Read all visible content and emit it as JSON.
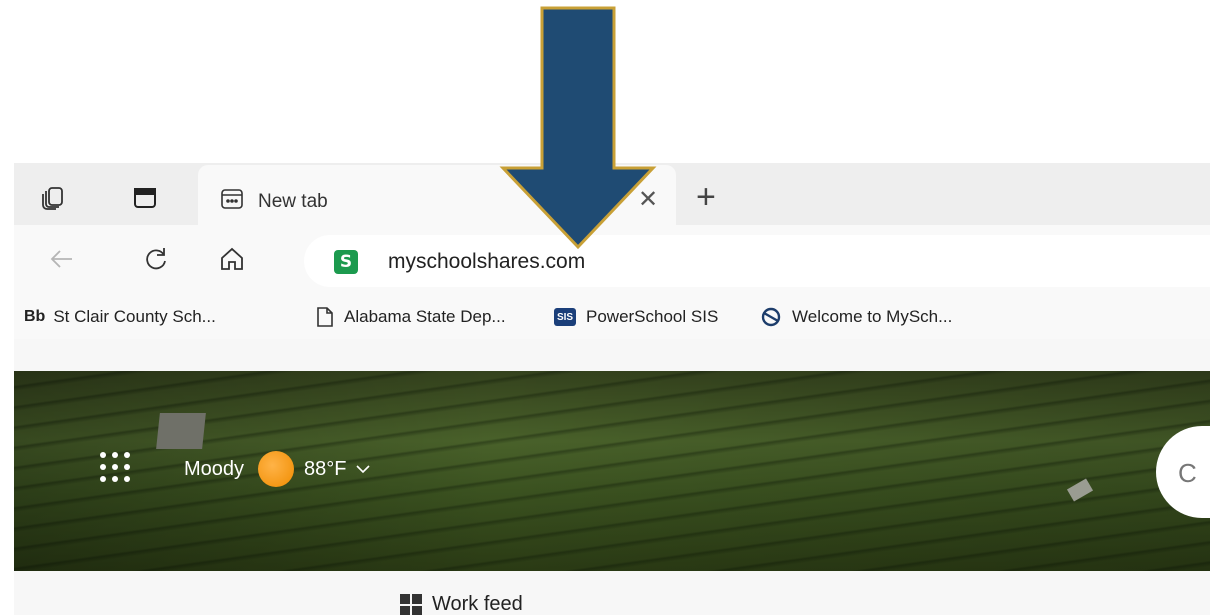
{
  "tab": {
    "title": "New tab",
    "close_glyph": "✕",
    "new_tab_glyph": "+"
  },
  "address": {
    "url": "myschoolshares.com",
    "site_icon_letter": "S"
  },
  "favorites": [
    {
      "icon_label": "Bb",
      "label": "St Clair County Sch..."
    },
    {
      "icon": "document-icon",
      "label": "Alabama State Dep..."
    },
    {
      "icon_label": "SIS",
      "label": "PowerSchool SIS"
    },
    {
      "icon": "myschool-icon",
      "label": "Welcome to MySch..."
    }
  ],
  "weather": {
    "location": "Moody",
    "temperature": "88°F"
  },
  "feed": {
    "label": "Work feed"
  },
  "colors": {
    "arrow_fill": "#1f4b73",
    "arrow_stroke": "#c8a036",
    "site_badge": "#1c9a4e",
    "sis_badge": "#1b3f7a"
  },
  "icons": [
    "workspaces-icon",
    "tab-actions-icon",
    "new-tab-page-icon",
    "close-icon",
    "plus-icon",
    "back-icon",
    "refresh-icon",
    "home-icon",
    "apps-grid-icon",
    "sun-icon",
    "chevron-down-icon",
    "search-icon",
    "grid-icon",
    "down-arrow-icon"
  ]
}
